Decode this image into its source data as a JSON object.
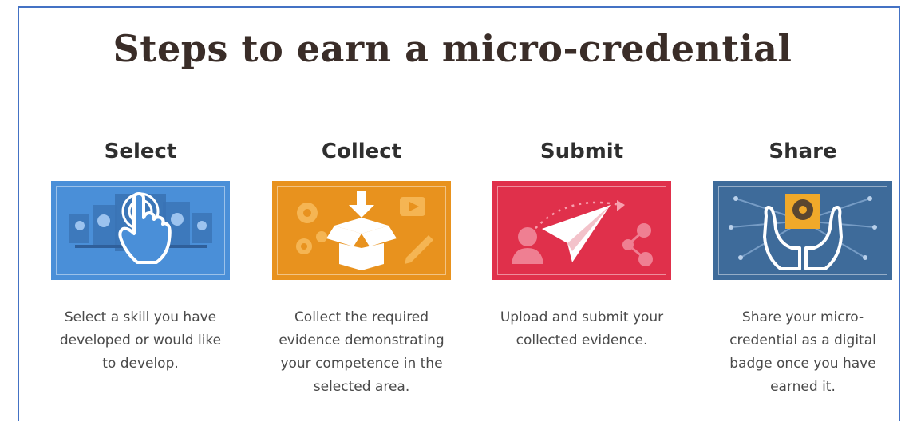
{
  "page": {
    "title": "Steps to earn a micro-credential"
  },
  "steps": [
    {
      "heading": "Select",
      "description": "Select a skill you have developed or would like to develop.",
      "color": "#4a8fd8",
      "icon": "pointing-hand-icon"
    },
    {
      "heading": "Collect",
      "description": "Collect the required evidence demonstrating your competence in the selected area.",
      "color": "#e8921e",
      "icon": "open-box-icon"
    },
    {
      "heading": "Submit",
      "description": "Upload and submit your collected evidence.",
      "color": "#e0304b",
      "icon": "paper-plane-icon"
    },
    {
      "heading": "Share",
      "description": "Share your micro-credential as a digital badge once you have earned it.",
      "color": "#3e6b9a",
      "icon": "hands-badge-icon"
    }
  ]
}
